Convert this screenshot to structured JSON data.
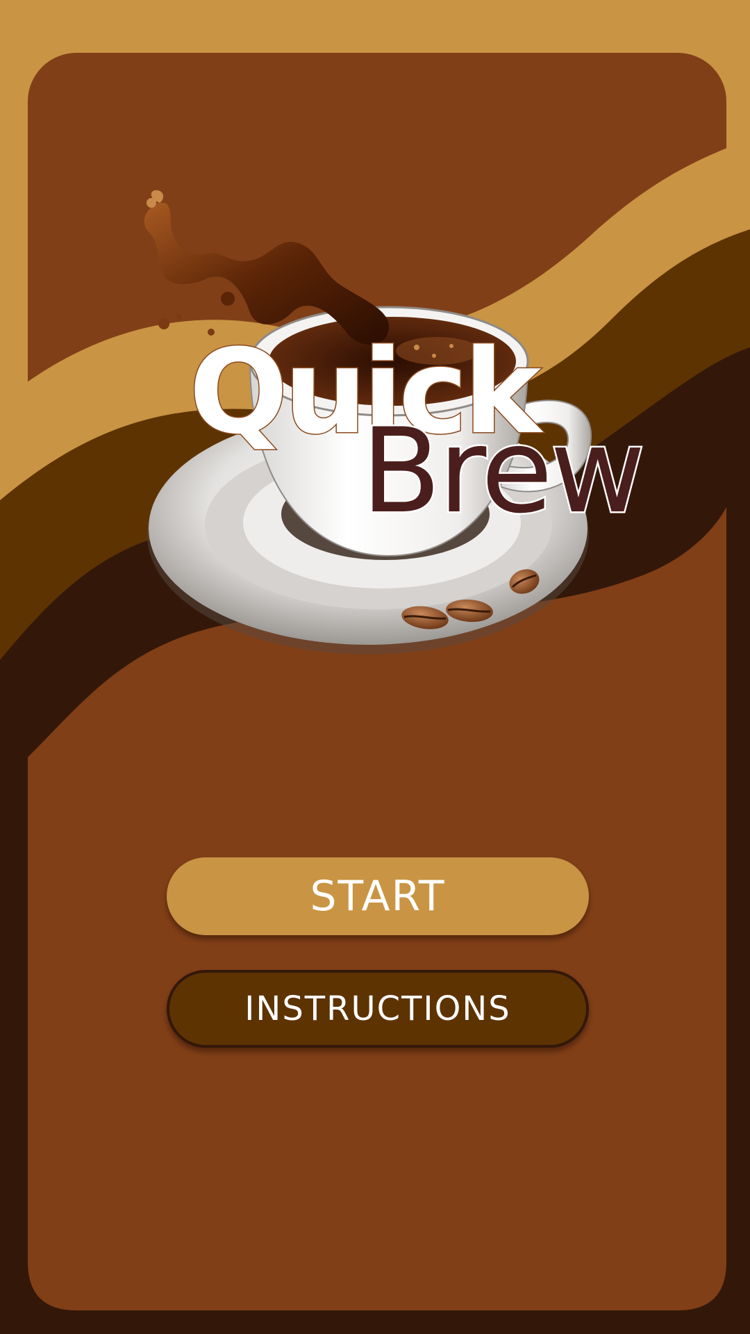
{
  "app": {
    "title_line1": "Quick",
    "title_line2": "Brew"
  },
  "menu": {
    "start_label": "START",
    "instructions_label": "INSTRUCTIONS"
  },
  "colors": {
    "outer_background": "#33180a",
    "panel_brown": "#813f17",
    "wave_tan": "#c99444",
    "wave_dark_brown": "#5e3302",
    "wave_darkest": "#33180a",
    "brew_text": "#4a1e1c"
  },
  "icons": {
    "logo": "coffee-cup-splash-icon",
    "beans": "coffee-bean-icon"
  }
}
